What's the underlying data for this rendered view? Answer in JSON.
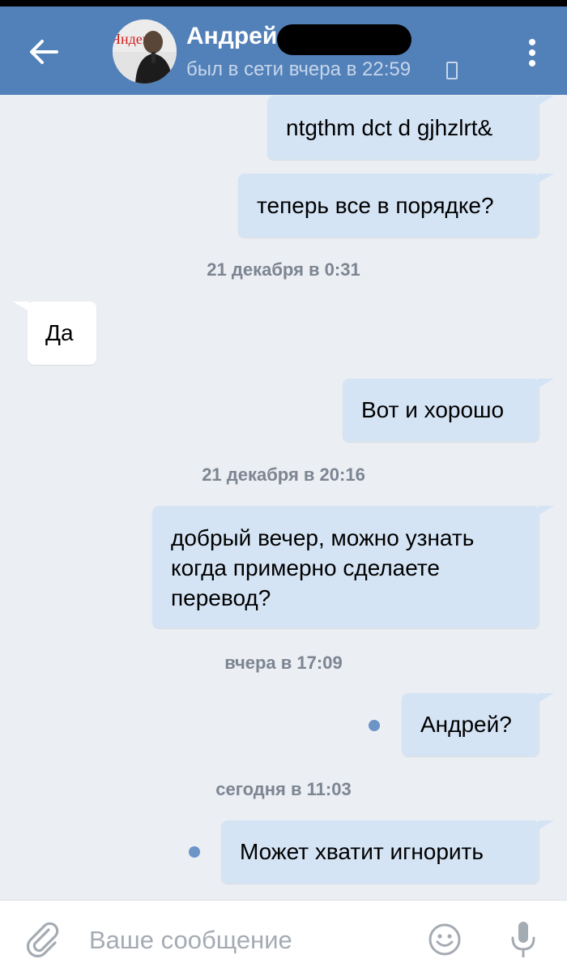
{
  "header": {
    "contact_name": "Андрей",
    "last_seen": "был в сети вчера в 22:59",
    "avatar_sign_text": "Яндекс",
    "icons": {
      "back": "arrow-left-icon",
      "menu": "more-vertical-icon",
      "status": "phone-icon"
    }
  },
  "messages": [
    {
      "direction": "out",
      "text": "ntgthm dct d gjhzlrt&"
    },
    {
      "direction": "out",
      "text": "теперь все в порядке?"
    },
    {
      "type": "date",
      "text": "21 декабря в 0:31"
    },
    {
      "direction": "in",
      "text": "Да"
    },
    {
      "direction": "out",
      "text": "Вот и хорошо"
    },
    {
      "type": "date",
      "text": "21 декабря в 20:16"
    },
    {
      "direction": "out",
      "text": "добрый вечер, можно узнать\nкогда примерно сделаете\nперевод?"
    },
    {
      "type": "date",
      "text": "вчера в 17:09"
    },
    {
      "direction": "out",
      "text": "Андрей?",
      "unread": true
    },
    {
      "type": "date",
      "text": "сегодня в 11:03"
    },
    {
      "direction": "out",
      "text": "Может хватит игнорить",
      "unread": true
    }
  ],
  "composer": {
    "placeholder": "Ваше сообщение",
    "icons": {
      "attach": "paperclip-icon",
      "emoji": "emoji-icon",
      "mic": "microphone-icon"
    }
  },
  "colors": {
    "header_bg": "#5280b9",
    "chat_bg": "#ebeef3",
    "outgoing_bubble": "#d5e4f5",
    "incoming_bubble": "#ffffff",
    "unread_dot": "#6d94c7"
  }
}
